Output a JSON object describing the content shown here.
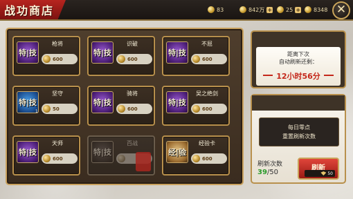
{
  "header": {
    "title": "战功商店",
    "resources": [
      {
        "icon": "coin-icon",
        "value": "83"
      },
      {
        "icon": "silver-icon",
        "value": "842万"
      },
      {
        "icon": "ticket-icon",
        "value": "25"
      },
      {
        "icon": "gem-icon",
        "value": "8348"
      }
    ],
    "close_label": "✕"
  },
  "shop": {
    "items": [
      {
        "name": "枪将",
        "badge": "特|技",
        "price": "600",
        "style": "purple",
        "qty": ""
      },
      {
        "name": "识破",
        "badge": "特|技",
        "price": "600",
        "style": "purple",
        "qty": ""
      },
      {
        "name": "不屈",
        "badge": "特|技",
        "price": "600",
        "style": "purple",
        "qty": ""
      },
      {
        "name": "坚守",
        "badge": "特|技",
        "price": "50",
        "style": "blue",
        "qty": "1"
      },
      {
        "name": "骑将",
        "badge": "特|技",
        "price": "600",
        "style": "purple",
        "qty": ""
      },
      {
        "name": "吴之绝剑",
        "badge": "特|技",
        "price": "600",
        "style": "purple",
        "qty": ""
      },
      {
        "name": "天师",
        "badge": "特|技",
        "price": "600",
        "style": "purple",
        "qty": ""
      },
      {
        "name": "百战",
        "badge": "特|技",
        "price": "",
        "style": "dark",
        "qty": "",
        "sold": true
      },
      {
        "name": "经验卡",
        "badge": "经|验",
        "price": "600",
        "style": "gold",
        "qty": ""
      }
    ]
  },
  "timer": {
    "line1": "距离下次",
    "line2": "自动刷新还剩：",
    "countdown": "12小时56分"
  },
  "refresh": {
    "info_line1": "每日零点",
    "info_line2": "重置刷新次数",
    "count_label": "刷新次数",
    "count_current": "39",
    "count_max": "/50",
    "button_label": "刷新",
    "cost": "50"
  }
}
